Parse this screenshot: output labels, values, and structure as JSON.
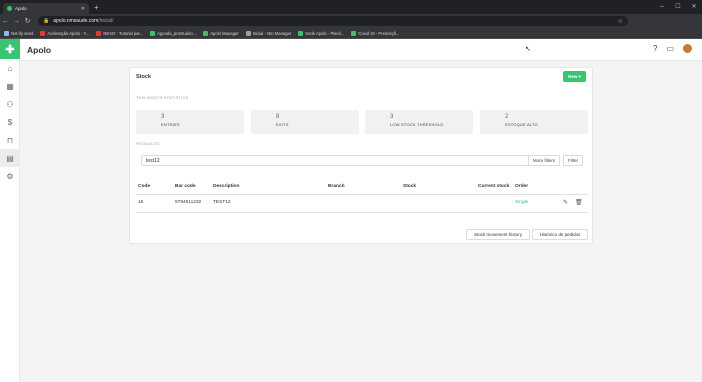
{
  "browser": {
    "tab_title": "Apolo",
    "url_host": "apolo.nmsaude.com",
    "url_path": "/inicial/",
    "bookmarks": [
      {
        "label": "Not-ify seed",
        "color": "#8ab4f8"
      },
      {
        "label": "Aceleração Apolo - Y...",
        "color": "#e53935"
      },
      {
        "label": "NEXO - Tutorial par...",
        "color": "#e53935"
      },
      {
        "label": "Agenda_prontuário...",
        "color": "#3fbf6a"
      },
      {
        "label": "Apolo Manager",
        "color": "#3fbf6a"
      },
      {
        "label": "Inicial - Nm Manager",
        "color": "#9e9e9e"
      },
      {
        "label": "Sede Apolo - Planil...",
        "color": "#3fbf6a"
      },
      {
        "label": "Covid 19 - Prescriçã...",
        "color": "#3fbf6a"
      }
    ]
  },
  "app": {
    "name": "Apolo",
    "accent": "#37c572"
  },
  "sidebar": {
    "icons": [
      "home-icon",
      "calendar-icon",
      "network-icon",
      "money-icon",
      "bag-icon",
      "table-icon",
      "gear-icon"
    ],
    "active_index": 5
  },
  "page": {
    "title": "Stock",
    "new_button": "New ▾",
    "stats_label": "THIS MONTH STATISTICS",
    "stats": [
      {
        "value": "3",
        "label": "ENTRIES"
      },
      {
        "value": "8",
        "label": "EXITS"
      },
      {
        "value": "3",
        "label": "LOW STOCK THRESHOLD"
      },
      {
        "value": "2",
        "label": "ESTOQUE ALTO"
      }
    ],
    "products_label": "PRODUCTS",
    "search_value": "test12",
    "more_filters": "More filters",
    "filter": "Filter",
    "columns": [
      "Code",
      "Bar code",
      "Description",
      "Branch",
      "Stock",
      "Current stock",
      "Order"
    ],
    "rows": [
      {
        "code": "16",
        "barcode": "9794611232",
        "description": "TEST12",
        "branch": "",
        "stock": "",
        "current_stock": "",
        "order": "Single"
      }
    ],
    "footer_buttons": [
      "Stock movement history",
      "Histórico de pedidos"
    ]
  }
}
